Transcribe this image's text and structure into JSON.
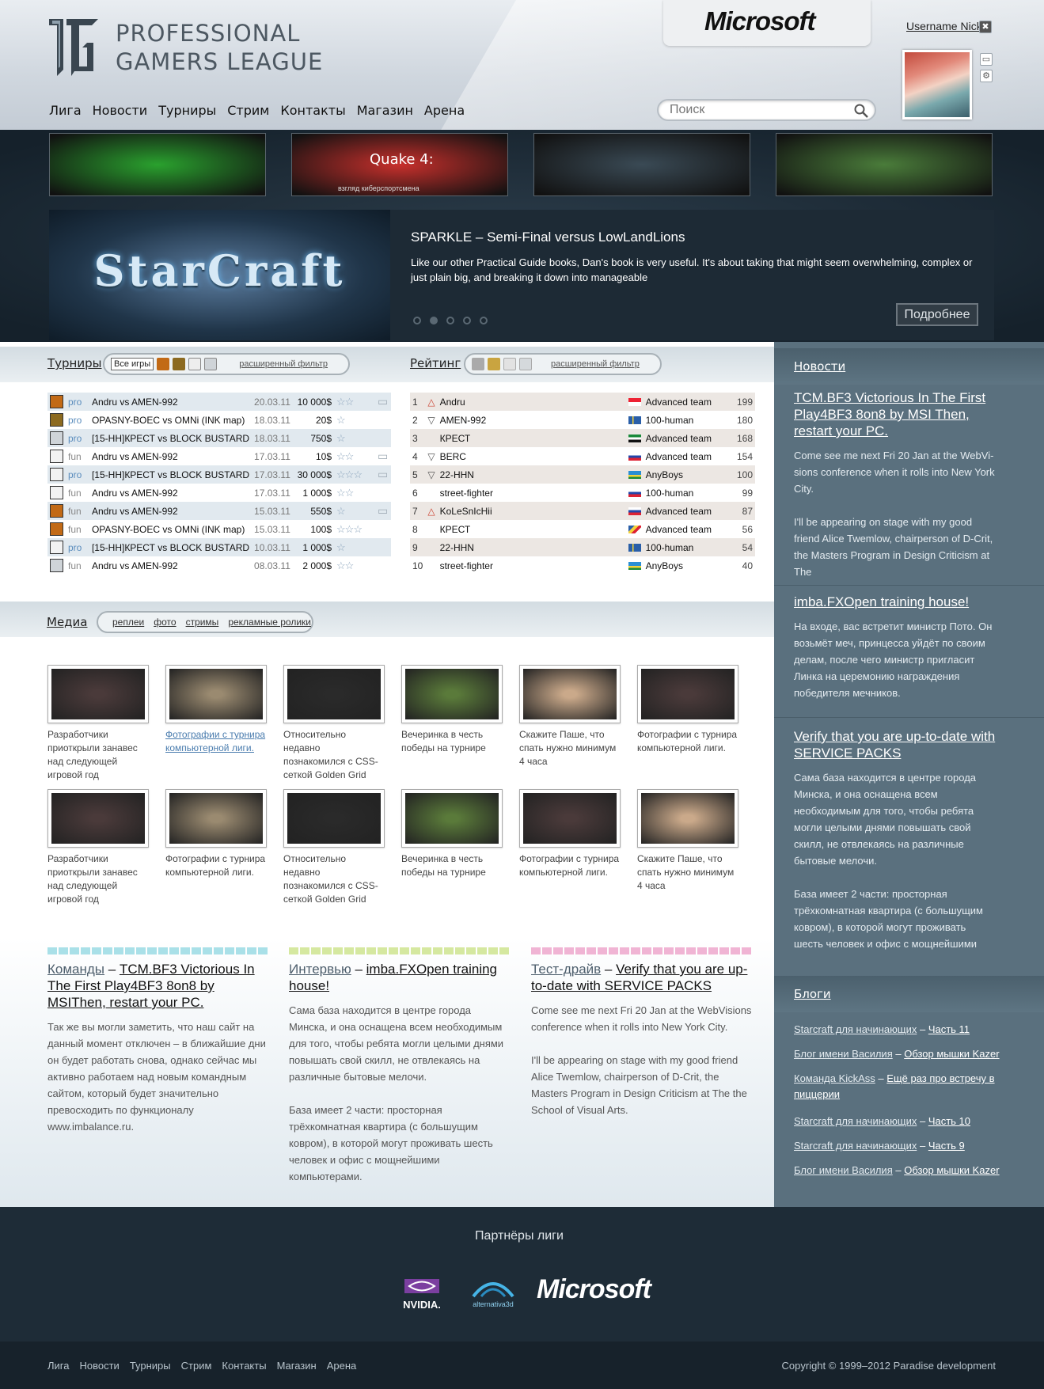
{
  "header": {
    "logo_line1": "PROFESSIONAL",
    "logo_line2": "GAMERS LEAGUE",
    "sponsor": "Microsoft",
    "username": "Username Nick",
    "close": "✖"
  },
  "nav": [
    "Лига",
    "Новости",
    "Турниры",
    "Стрим",
    "Контакты",
    "Магазин",
    "Арена"
  ],
  "search": {
    "placeholder": "Поиск"
  },
  "thumbs": [
    {
      "label": "",
      "bg": "#2aa12e"
    },
    {
      "label": "Quake 4:",
      "sub": "взгляд киберспортсмена",
      "bg": "#c8302c"
    },
    {
      "label": "",
      "bg": "#3a4a55"
    },
    {
      "label": "",
      "bg": "#4a7c3a"
    }
  ],
  "slider": {
    "image_title": "StarCraft",
    "title": "SPARKLE – Semi-Final versus LowLandLions",
    "text": "Like our other Practical Guide books, Dan's book is very useful. It's about taking that might seem overwhelming, complex or just plain big, and breaking it down into manageable",
    "button": "Подробнее",
    "active_dot": 2
  },
  "tournaments": {
    "title": "Турниры",
    "all_games": "Все игры",
    "filter": "расширенный фильтр",
    "rows": [
      {
        "game": "hl",
        "level": "pro",
        "match": "Andru vs AMEN-992",
        "date": "20.03.11",
        "amount": "10 000$",
        "stars": "☆☆",
        "comment": true
      },
      {
        "game": "wc",
        "level": "pro",
        "match": "OPASNY-BOEC vs OMNi (INK map)",
        "date": "18.03.11",
        "amount": "20$",
        "stars": "☆",
        "comment": false
      },
      {
        "game": "sc",
        "level": "pro",
        "match": "[15-HH]КРЕСТ vs BLOCK BUSTARD",
        "date": "18.03.11",
        "amount": "750$",
        "stars": "☆",
        "comment": false
      },
      {
        "game": "cs",
        "level": "fun",
        "match": "Andru vs AMEN-992",
        "date": "17.03.11",
        "amount": "10$",
        "stars": "☆☆",
        "comment": true
      },
      {
        "game": "cs",
        "level": "pro",
        "match": "[15-HH]КРЕСТ vs BLOCK BUSTARD",
        "date": "17.03.11",
        "amount": "30 000$",
        "stars": "☆☆☆",
        "comment": true
      },
      {
        "game": "cs",
        "level": "fun",
        "match": "Andru vs AMEN-992",
        "date": "17.03.11",
        "amount": "1 000$",
        "stars": "☆☆",
        "comment": false
      },
      {
        "game": "hl",
        "level": "fun",
        "match": "Andru vs AMEN-992",
        "date": "15.03.11",
        "amount": "550$",
        "stars": "☆",
        "comment": true
      },
      {
        "game": "hl",
        "level": "fun",
        "match": "OPASNY-BOEC vs OMNi (INK map)",
        "date": "15.03.11",
        "amount": "100$",
        "stars": "☆☆☆",
        "comment": false
      },
      {
        "game": "cs",
        "level": "pro",
        "match": "[15-HH]КРЕСТ vs BLOCK BUSTARD",
        "date": "10.03.11",
        "amount": "1 000$",
        "stars": "☆",
        "comment": false
      },
      {
        "game": "sc",
        "level": "fun",
        "match": "Andru vs AMEN-992",
        "date": "08.03.11",
        "amount": "2 000$",
        "stars": "☆☆",
        "comment": false
      }
    ]
  },
  "rating": {
    "title": "Рейтинг",
    "filter": "расширенный фильтр",
    "rows": [
      {
        "pos": "1",
        "trend": "up",
        "name": "Andru",
        "flag": "sg",
        "team": "Advanced team",
        "score": "199"
      },
      {
        "pos": "2",
        "trend": "down",
        "name": "AMEN-992",
        "flag": "se",
        "team": "100-human",
        "score": "180"
      },
      {
        "pos": "3",
        "trend": "",
        "name": "КРЕСТ",
        "flag": "ae",
        "team": "Advanced team",
        "score": "168"
      },
      {
        "pos": "4",
        "trend": "down",
        "name": "BERC",
        "flag": "ru",
        "team": "Advanced team",
        "score": "154"
      },
      {
        "pos": "5",
        "trend": "down",
        "name": "22-HHN",
        "flag": "rw",
        "team": "AnyBoys",
        "score": "100"
      },
      {
        "pos": "6",
        "trend": "",
        "name": "street-fighter",
        "flag": "ru",
        "team": "100-human",
        "score": "99"
      },
      {
        "pos": "7",
        "trend": "up",
        "name": "KoLeSnIcHii",
        "flag": "ru",
        "team": "Advanced team",
        "score": "87"
      },
      {
        "pos": "8",
        "trend": "",
        "name": "КРЕСТ",
        "flag": "sc",
        "team": "Advanced team",
        "score": "56"
      },
      {
        "pos": "9",
        "trend": "",
        "name": "22-HHN",
        "flag": "se",
        "team": "100-human",
        "score": "54"
      },
      {
        "pos": "10",
        "trend": "",
        "name": "street-fighter",
        "flag": "rw",
        "team": "AnyBoys",
        "score": "40"
      }
    ]
  },
  "media": {
    "title": "Медиа",
    "tabs": [
      "реплеи",
      "фото",
      "стримы",
      "рекламные ролики"
    ],
    "items": [
      {
        "caption": "Разработчики приоткрыли занавес над следующей игровой год",
        "bg": "#4a3a3a"
      },
      {
        "caption": "Фотографии с турнира компьютерной лиги.",
        "bg": "#9a8a70",
        "hover": true
      },
      {
        "caption": "Относительно недавно познакомился с CSS-сеткой Golden Grid",
        "bg": "#2a2a2a"
      },
      {
        "caption": "Вечеринка в честь победы на турнире",
        "bg": "#5a7a3a"
      },
      {
        "caption": "Скажите Паше, что спать нужно минимум 4 часа",
        "bg": "#caa98a"
      },
      {
        "caption": "Фотографии с турнира компьютерной лиги.",
        "bg": "#4a3a3a"
      },
      {
        "caption": "Разработчики приоткрыли занавес над следующей игровой год",
        "bg": "#4a3a3a"
      },
      {
        "caption": "Фотографии с турнира компьютерной лиги.",
        "bg": "#9a8a70"
      },
      {
        "caption": "Относительно недавно познакомился с CSS-сеткой Golden Grid",
        "bg": "#2a2a2a"
      },
      {
        "caption": "Вечеринка в честь победы на турнире",
        "bg": "#5a7a3a"
      },
      {
        "caption": "Фотографии с турнира компьютерной лиги.",
        "bg": "#4a3a3a"
      },
      {
        "caption": "Скажите Паше, что спать нужно минимум 4 часа",
        "bg": "#caa98a"
      }
    ]
  },
  "columns": [
    {
      "category": "Команды",
      "title": "TCM.BF3 Victorious In The First Play4BF3 8on8 by  MSIThen, restart your PC.",
      "text": "Так же вы могли заметить, что наш сайт на данный момент отключен – в ближайшие дни он будет работать снова, однако сейчас мы активно работаем над новым командным сайтом, который будет значительно превосходить по функционалу www.imbalance.ru.",
      "accent": "#a9e0e8"
    },
    {
      "category": "Интервью",
      "title": "imba.FXOpen training house!",
      "text": "Сама база находится в центре города Минска, и она оснащена всем необходимым для того, чтобы ребята могли целыми днями повышать свой скилл, не отвлекаясь на различные бытовые мелочи.\n\nБаза имеет 2 части: просторная трёхкомнатная квартира (с большущим ковром), в которой могут проживать шесть человек и офис с мощнейшими компьютерами.",
      "accent": "#d5e8a0"
    },
    {
      "category": "Тест-драйв",
      "title": "Verify that you are up-to-date with SERVICE PACKS",
      "text": "Come see me next Fri 20 Jan at the WebVisions conference when it rolls into New York City.\n\nI'll be appearing on stage with my good friend Alice Twemlow, chairperson of D-Crit, the Masters Program in Design Criticism at The the School of Visual Arts.",
      "accent": "#f0b4d4"
    }
  ],
  "sidebar": {
    "news_title": "Новости",
    "news": [
      {
        "title": "TCM.BF3 Victorious In The First Play4BF3 8on8 by MSI Then, restart your PC.",
        "text": "Come see me next Fri 20 Jan at the WebVi-sions conference when it rolls into New York City.\n\nI'll be appearing on stage with my good friend Alice Twemlow, chairperson of D-Crit, the Masters Program in Design Criticism at The"
      },
      {
        "title": "imba.FXOpen training house!",
        "text": "На входе, вас встретит министр Пото. Он возьмёт меч, принцесса уйдёт по своим делам, после чего министр пригласит Линка на церемонию награждения победителя мечников."
      },
      {
        "title": "Verify that you are up-to-date with SERVICE PACKS",
        "text": "Сама база находится в центре города Минска, и она оснащена всем необходимым для того, чтобы ребята могли целыми днями повышать свой скилл, не отвлекаясь на различные бытовые мелочи.\n\nБаза имеет 2 части: просторная трёхкомнатная квартира (с большущим ковром), в которой могут проживать шесть человек и офис с мощнейшими"
      }
    ],
    "blogs_title": "Блоги",
    "blogs": [
      {
        "a": "Starcraft для начинающих",
        "b": "Часть 11"
      },
      {
        "a": "Блог имени Василия",
        "b": "Обзор мышки Kazer"
      },
      {
        "a": "Команда KickAss",
        "b": "Ещё раз про встречу в пиццерии"
      },
      {
        "a": "Starcraft для начинающих",
        "b": "Часть 10"
      },
      {
        "a": "Starcraft для начинающих",
        "b": "Часть 9"
      },
      {
        "a": "Блог имени Василия",
        "b": "Обзор мышки Kazer"
      }
    ]
  },
  "footer": {
    "partners_title": "Партнёры лиги",
    "partners": [
      "NVIDIA.",
      "alternativa3d",
      "Microsoft"
    ],
    "nav": [
      "Лига",
      "Новости",
      "Турниры",
      "Стрим",
      "Контакты",
      "Магазин",
      "Арена"
    ],
    "copyright": "Copyright © 1999–2012 Paradise development"
  },
  "colors": {
    "accent_blue": "#5b8dbd",
    "sidebar": "#5a707e",
    "dark": "#1e2c37"
  }
}
